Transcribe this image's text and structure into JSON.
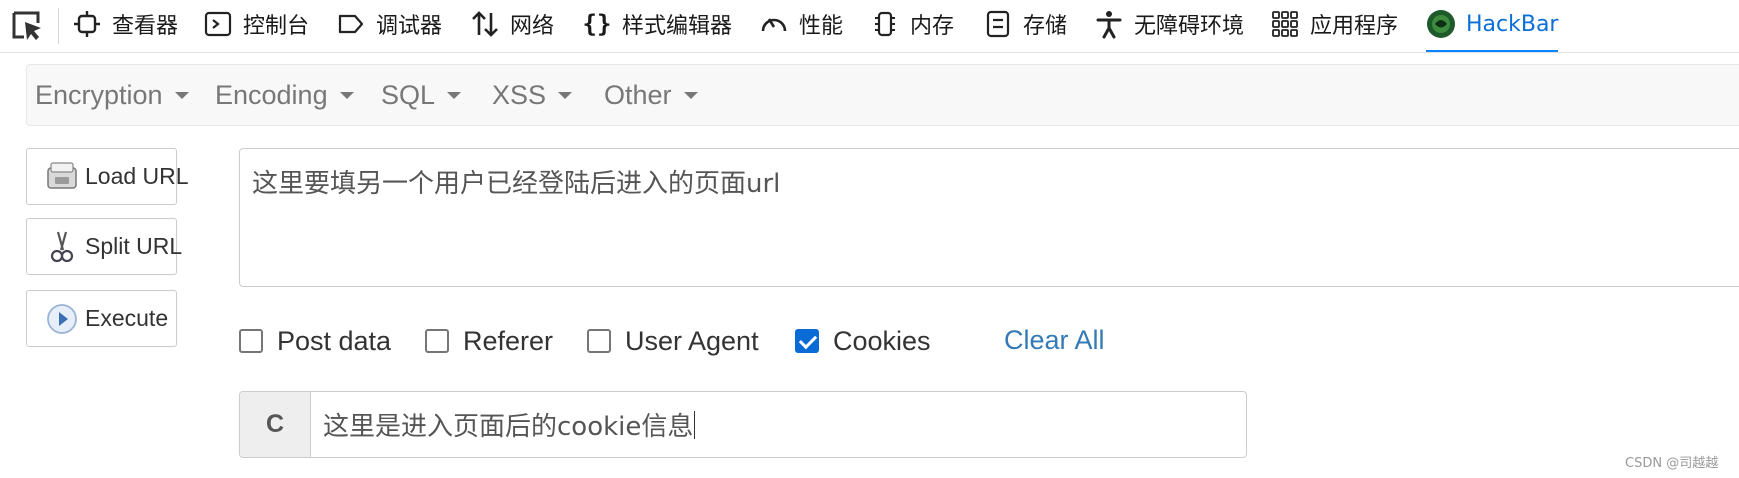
{
  "devtools": {
    "tabs": [
      {
        "label": "查看器",
        "icon": "inspector-icon"
      },
      {
        "label": "控制台",
        "icon": "console-icon"
      },
      {
        "label": "调试器",
        "icon": "debugger-icon"
      },
      {
        "label": "网络",
        "icon": "network-icon"
      },
      {
        "label": "样式编辑器",
        "icon": "style-editor-icon"
      },
      {
        "label": "性能",
        "icon": "performance-icon"
      },
      {
        "label": "内存",
        "icon": "memory-icon"
      },
      {
        "label": "存储",
        "icon": "storage-icon"
      },
      {
        "label": "无障碍环境",
        "icon": "accessibility-icon"
      },
      {
        "label": "应用程序",
        "icon": "application-icon"
      },
      {
        "label": "HackBar",
        "icon": "hackbar-logo-icon",
        "active": true
      }
    ],
    "accent_color": "#0a84ff"
  },
  "hackbar": {
    "menu": [
      "Encryption",
      "Encoding",
      "SQL",
      "XSS",
      "Other"
    ],
    "buttons": {
      "load_url": "Load URL",
      "split_url": "Split URL",
      "execute": "Execute"
    },
    "url_value": "这里要填另一个用户已经登陆后进入的页面url",
    "options": [
      {
        "label": "Post data",
        "checked": false
      },
      {
        "label": "Referer",
        "checked": false
      },
      {
        "label": "User Agent",
        "checked": false
      },
      {
        "label": "Cookies",
        "checked": true
      }
    ],
    "clear_all": "Clear All",
    "cookie": {
      "addon": "C",
      "value": "这里是进入页面后的cookie信息"
    },
    "link_color": "#337ab7"
  },
  "watermark": "CSDN @司越越"
}
